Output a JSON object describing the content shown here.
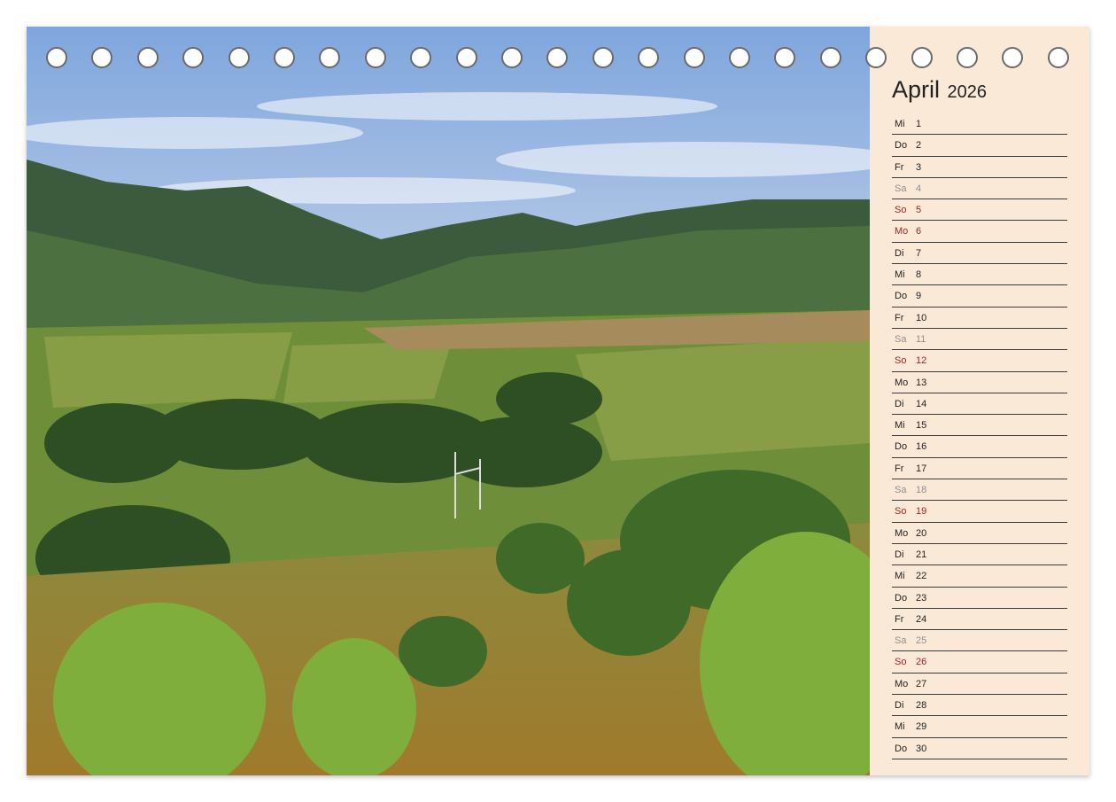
{
  "calendar": {
    "month": "April",
    "year": "2026",
    "days": [
      {
        "wd": "Mi",
        "d": "1",
        "t": "n"
      },
      {
        "wd": "Do",
        "d": "2",
        "t": "n"
      },
      {
        "wd": "Fr",
        "d": "3",
        "t": "n"
      },
      {
        "wd": "Sa",
        "d": "4",
        "t": "sat"
      },
      {
        "wd": "So",
        "d": "5",
        "t": "sun"
      },
      {
        "wd": "Mo",
        "d": "6",
        "t": "sun"
      },
      {
        "wd": "Di",
        "d": "7",
        "t": "n"
      },
      {
        "wd": "Mi",
        "d": "8",
        "t": "n"
      },
      {
        "wd": "Do",
        "d": "9",
        "t": "n"
      },
      {
        "wd": "Fr",
        "d": "10",
        "t": "n"
      },
      {
        "wd": "Sa",
        "d": "11",
        "t": "sat"
      },
      {
        "wd": "So",
        "d": "12",
        "t": "sun"
      },
      {
        "wd": "Mo",
        "d": "13",
        "t": "n"
      },
      {
        "wd": "Di",
        "d": "14",
        "t": "n"
      },
      {
        "wd": "Mi",
        "d": "15",
        "t": "n"
      },
      {
        "wd": "Do",
        "d": "16",
        "t": "n"
      },
      {
        "wd": "Fr",
        "d": "17",
        "t": "n"
      },
      {
        "wd": "Sa",
        "d": "18",
        "t": "sat"
      },
      {
        "wd": "So",
        "d": "19",
        "t": "sun"
      },
      {
        "wd": "Mo",
        "d": "20",
        "t": "n"
      },
      {
        "wd": "Di",
        "d": "21",
        "t": "n"
      },
      {
        "wd": "Mi",
        "d": "22",
        "t": "n"
      },
      {
        "wd": "Do",
        "d": "23",
        "t": "n"
      },
      {
        "wd": "Fr",
        "d": "24",
        "t": "n"
      },
      {
        "wd": "Sa",
        "d": "25",
        "t": "sat"
      },
      {
        "wd": "So",
        "d": "26",
        "t": "sun"
      },
      {
        "wd": "Mo",
        "d": "27",
        "t": "n"
      },
      {
        "wd": "Di",
        "d": "28",
        "t": "n"
      },
      {
        "wd": "Mi",
        "d": "29",
        "t": "n"
      },
      {
        "wd": "Do",
        "d": "30",
        "t": "n"
      }
    ]
  },
  "colors": {
    "panel_background": "#fbe9d8",
    "sunday_holiday": "#a42428",
    "saturday": "#8e8e8e",
    "weekday": "#222222"
  },
  "photo": {
    "icon": "landscape-photo"
  }
}
